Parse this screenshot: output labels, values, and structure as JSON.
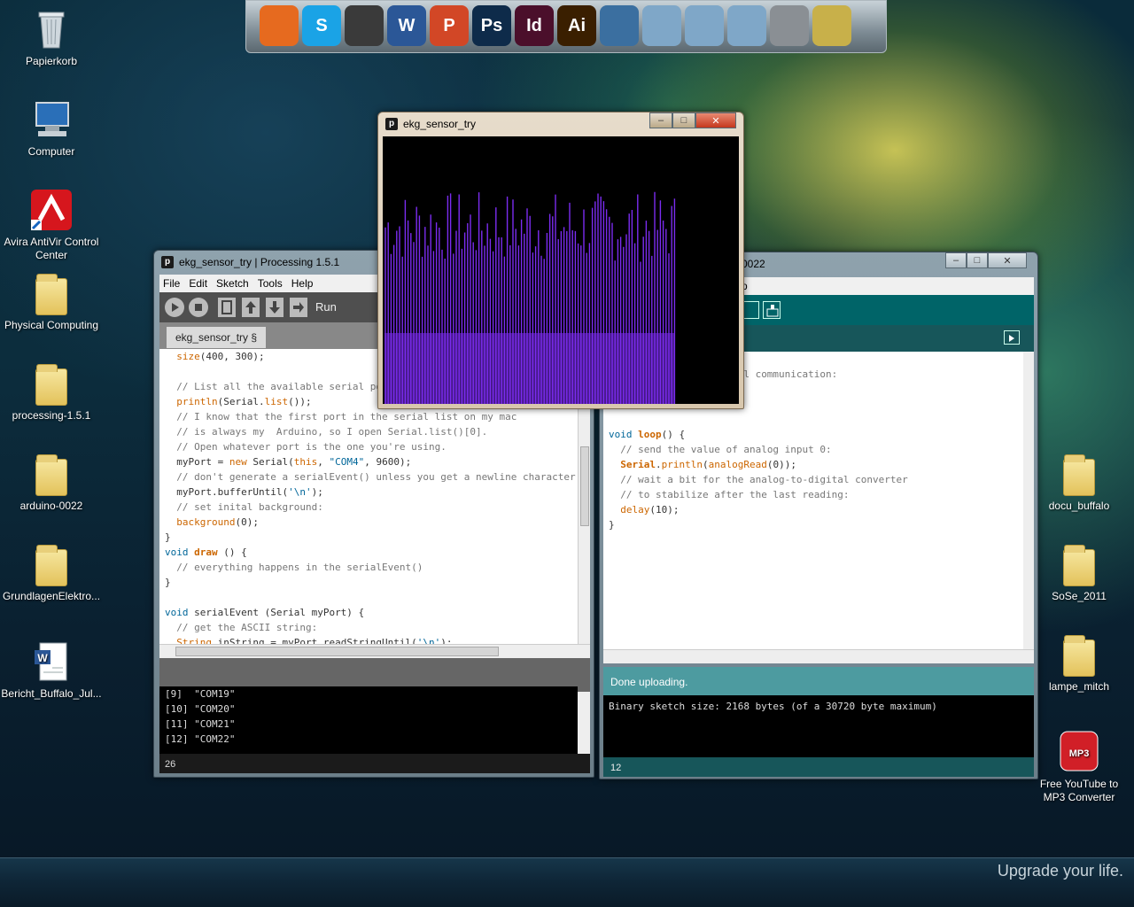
{
  "desktop": {
    "left_icons": [
      {
        "label": "Papierkorb"
      },
      {
        "label": "Computer"
      },
      {
        "label": "Avira AntiVir Control Center"
      },
      {
        "label": "Physical Computing"
      },
      {
        "label": "processing-1.5.1"
      },
      {
        "label": "arduino-0022"
      },
      {
        "label": "GrundlagenElektro..."
      },
      {
        "label": "Bericht_Buffalo_Jul..."
      }
    ],
    "right_icons": [
      {
        "label": "docu_buffalo"
      },
      {
        "label": "SoSe_2011"
      },
      {
        "label": "lampe_mitch"
      },
      {
        "label": "Free YouTube to MP3 Converter"
      }
    ],
    "tagline": "Upgrade your life."
  },
  "dock": {
    "items": [
      {
        "name": "firefox",
        "text": "",
        "color": "#e66a1f"
      },
      {
        "name": "skype",
        "text": "S",
        "color": "#1aa3e6"
      },
      {
        "name": "inkscape",
        "text": "",
        "color": "#3a3a3a"
      },
      {
        "name": "word",
        "text": "W",
        "color": "#2b5797"
      },
      {
        "name": "powerpoint",
        "text": "P",
        "color": "#d24726"
      },
      {
        "name": "photoshop",
        "text": "Ps",
        "color": "#0e2b4a"
      },
      {
        "name": "indesign",
        "text": "Id",
        "color": "#4b0f2b"
      },
      {
        "name": "illustrator",
        "text": "Ai",
        "color": "#3a1f00"
      },
      {
        "name": "globe",
        "text": "",
        "color": "#3b6fa0"
      },
      {
        "name": "folder1",
        "text": "",
        "color": "#7fa7c8"
      },
      {
        "name": "folder2",
        "text": "",
        "color": "#7fa7c8"
      },
      {
        "name": "folder3",
        "text": "",
        "color": "#7fa7c8"
      },
      {
        "name": "tools",
        "text": "",
        "color": "#8a8f94"
      },
      {
        "name": "settings",
        "text": "",
        "color": "#c8b04a"
      }
    ]
  },
  "processing": {
    "title": "ekg_sensor_try | Processing 1.5.1",
    "menu": [
      "File",
      "Edit",
      "Sketch",
      "Tools",
      "Help"
    ],
    "run_label": "Run",
    "tab": "ekg_sensor_try §",
    "console_lines": [
      "[9]  \"COM19\"",
      "[10] \"COM20\"",
      "[11] \"COM21\"",
      "[12] \"COM22\""
    ],
    "line_number": "26"
  },
  "arduino": {
    "title_fragment": "0022",
    "menu_fragment": "p",
    "status": "Done uploading.",
    "console": "Binary sketch size: 2168 bytes (of a 30720 byte maximum)",
    "line_number": "12"
  },
  "sketch_window": {
    "title": "ekg_sensor_try",
    "bar_color": "#7b2cf0"
  },
  "window_controls": {
    "minimize": "–",
    "maximize": "□",
    "close": "✕"
  }
}
